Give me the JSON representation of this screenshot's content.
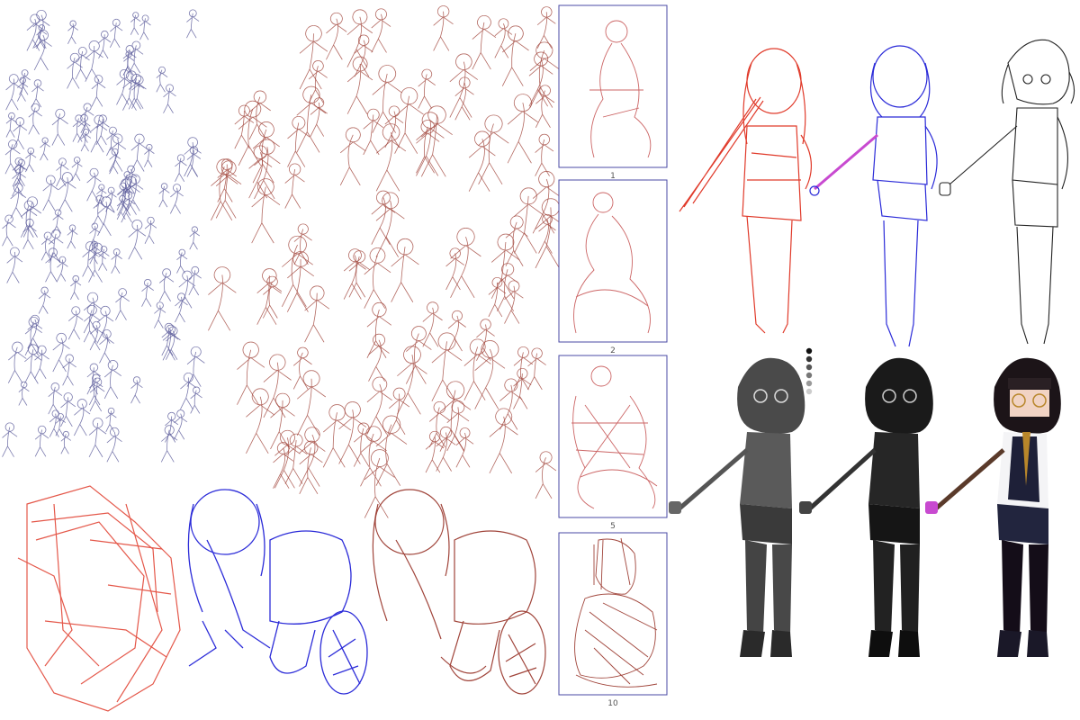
{
  "artwork": {
    "frames": [
      {
        "label": "1"
      },
      {
        "label": "2"
      },
      {
        "label": "5"
      },
      {
        "label": "10"
      }
    ],
    "palette": {
      "blue_sketch": "#5a5a9a",
      "red_sketch": "#a0443a",
      "bright_red": "#e03a2a",
      "bright_blue": "#2b2bd8",
      "frame_blue": "#4a4aa6",
      "line_black": "#222222",
      "grey_render": "#4a4a4a",
      "dark_render": "#1a1a1a",
      "hair_color": "#1c1418",
      "vest_color": "#1e2038",
      "shirt_color": "#f4f4f6",
      "tie_color": "#b8862a",
      "staff_tip_color": "#c84ad0"
    },
    "swatches": [
      "#111111",
      "#333333",
      "#555555",
      "#777777",
      "#999999",
      "#cccccc"
    ]
  }
}
